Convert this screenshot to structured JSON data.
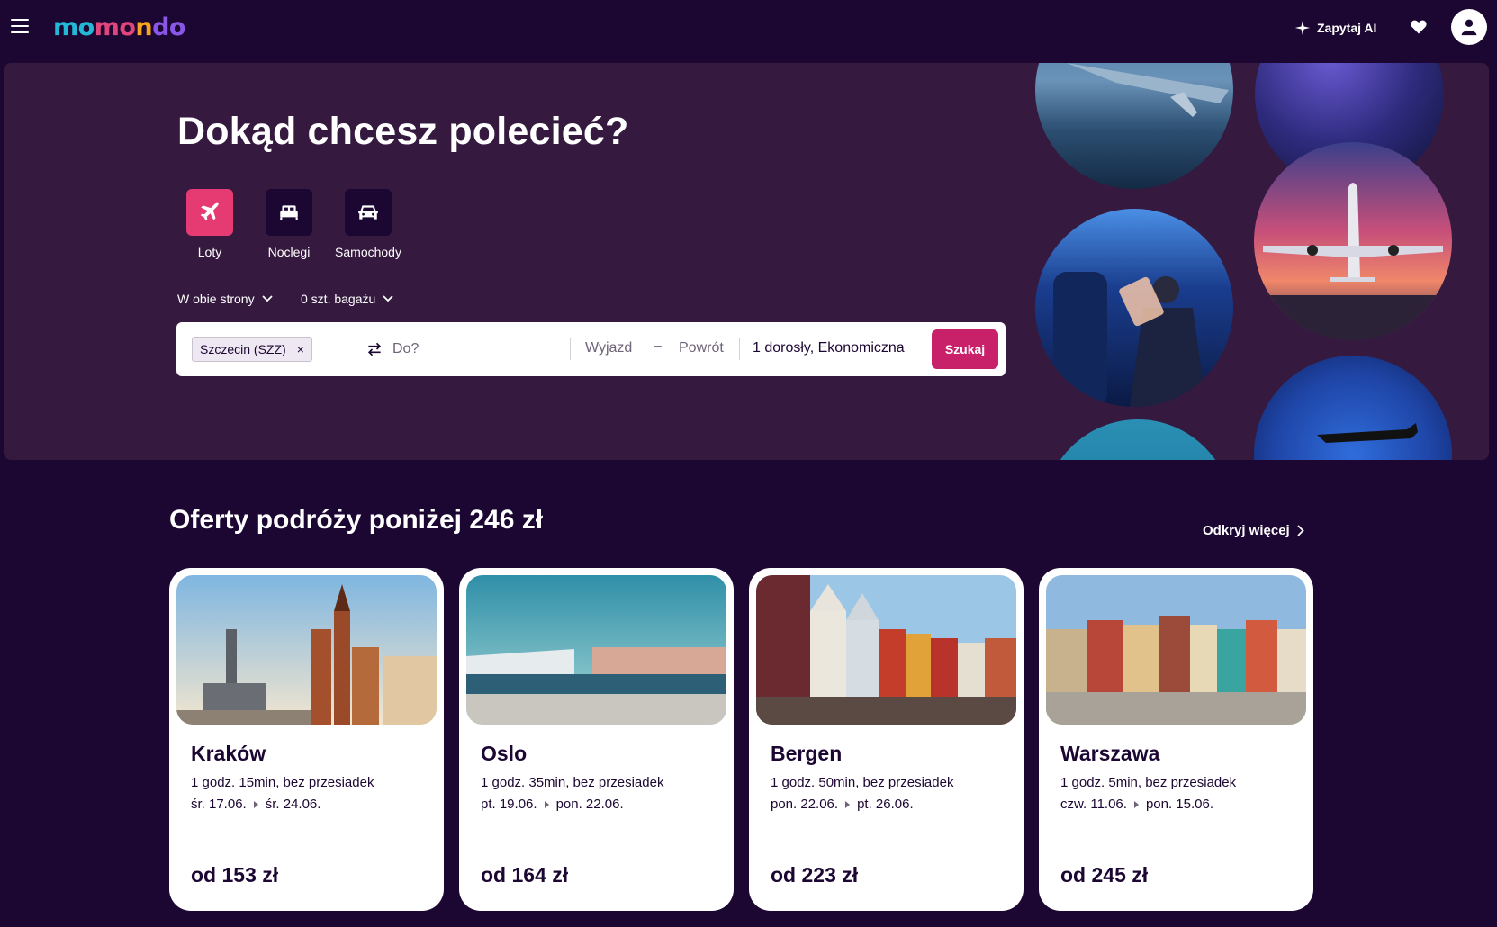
{
  "header": {
    "logo_letters": [
      "mo",
      "mo",
      "n",
      "do"
    ],
    "ask_ai_label": "Zapytaj AI",
    "icons": [
      "menu-icon",
      "sparkle-icon",
      "heart-icon",
      "user-icon"
    ]
  },
  "hero": {
    "title": "Dokąd chcesz polecieć?",
    "tabs": [
      {
        "label": "Loty",
        "icon": "plane-icon",
        "active": true
      },
      {
        "label": "Noclegi",
        "icon": "bed-icon",
        "active": false
      },
      {
        "label": "Samochody",
        "icon": "car-icon",
        "active": false
      }
    ],
    "trip_type": "W obie strony",
    "bags": "0 szt. bagażu",
    "search": {
      "origin_chip": "Szczecin (SZZ)",
      "chip_remove": "×",
      "destination_placeholder": "Do?",
      "depart_placeholder": "Wyjazd",
      "date_dash": "–",
      "return_placeholder": "Powrót",
      "travelers": "1 dorosły, Ekonomiczna",
      "search_label": "Szukaj"
    }
  },
  "deals": {
    "title": "Oferty podróży poniżej 246 zł",
    "discover_label": "Odkryj więcej",
    "cards": [
      {
        "city": "Kraków",
        "duration": "1 godz. 15min, bez przesiadek",
        "date_from": "śr. 17.06.",
        "date_to": "śr. 24.06.",
        "price": "od 153 zł"
      },
      {
        "city": "Oslo",
        "duration": "1 godz. 35min, bez przesiadek",
        "date_from": "pt. 19.06.",
        "date_to": "pon. 22.06.",
        "price": "od 164 zł"
      },
      {
        "city": "Bergen",
        "duration": "1 godz. 50min, bez przesiadek",
        "date_from": "pon. 22.06.",
        "date_to": "pt. 26.06.",
        "price": "od 223 zł"
      },
      {
        "city": "Warszawa",
        "duration": "1 godz. 5min, bez przesiadek",
        "date_from": "czw. 11.06.",
        "date_to": "pon. 15.06.",
        "price": "od 245 zł"
      }
    ]
  },
  "colors": {
    "page_bg": "#1c0732",
    "hero_bg": "#35193f",
    "active_tab": "#e53a72",
    "search_button": "#c9206a"
  }
}
